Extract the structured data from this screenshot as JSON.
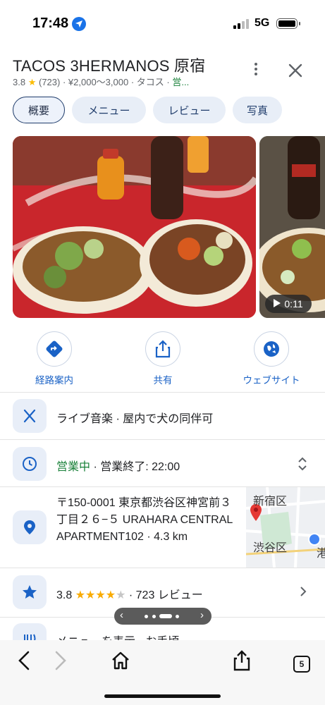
{
  "status_bar": {
    "time": "17:48",
    "network": "5G",
    "location_icon": "location-arrow-icon"
  },
  "place": {
    "name": "TACOS 3HERMANOS 原宿",
    "rating": "3.8",
    "rating_star": "★",
    "review_count": "(723)",
    "price": "¥2,000〜3,000",
    "category": "タコス",
    "status_truncated": "営...",
    "sep": " · "
  },
  "tabs": [
    "概要",
    "メニュー",
    "レビュー",
    "写真"
  ],
  "photos": {
    "video_duration": "0:11"
  },
  "actions": [
    {
      "label": "経路案内",
      "icon": "directions-icon"
    },
    {
      "label": "共有",
      "icon": "share-icon"
    },
    {
      "label": "ウェブサイト",
      "icon": "globe-icon"
    }
  ],
  "info": {
    "amenities": "ライブ音楽 · 屋内で犬の同伴可",
    "hours_status": "営業中",
    "hours_detail": " · 営業終了: 22:00",
    "address": "〒150-0001 東京都渋谷区神宮前３丁目２６−５ URAHARA CENTRAL APARTMENT102",
    "distance": " · 4.3 km",
    "map_labels": [
      "新宿区",
      "渋谷区",
      "港"
    ],
    "rating": "3.8",
    "rating_stars_filled": 4,
    "rating_stars_display": "★★★★",
    "rating_star_empty": "★",
    "reviews": " · 723 レビュー",
    "menu_row": "メニューを表示 · お手頃"
  },
  "browser": {
    "tab_count": "5"
  },
  "colors": {
    "accent": "#1a73e8",
    "open_green": "#188038",
    "star": "#fbbc04",
    "brand_red": "#d93025"
  }
}
